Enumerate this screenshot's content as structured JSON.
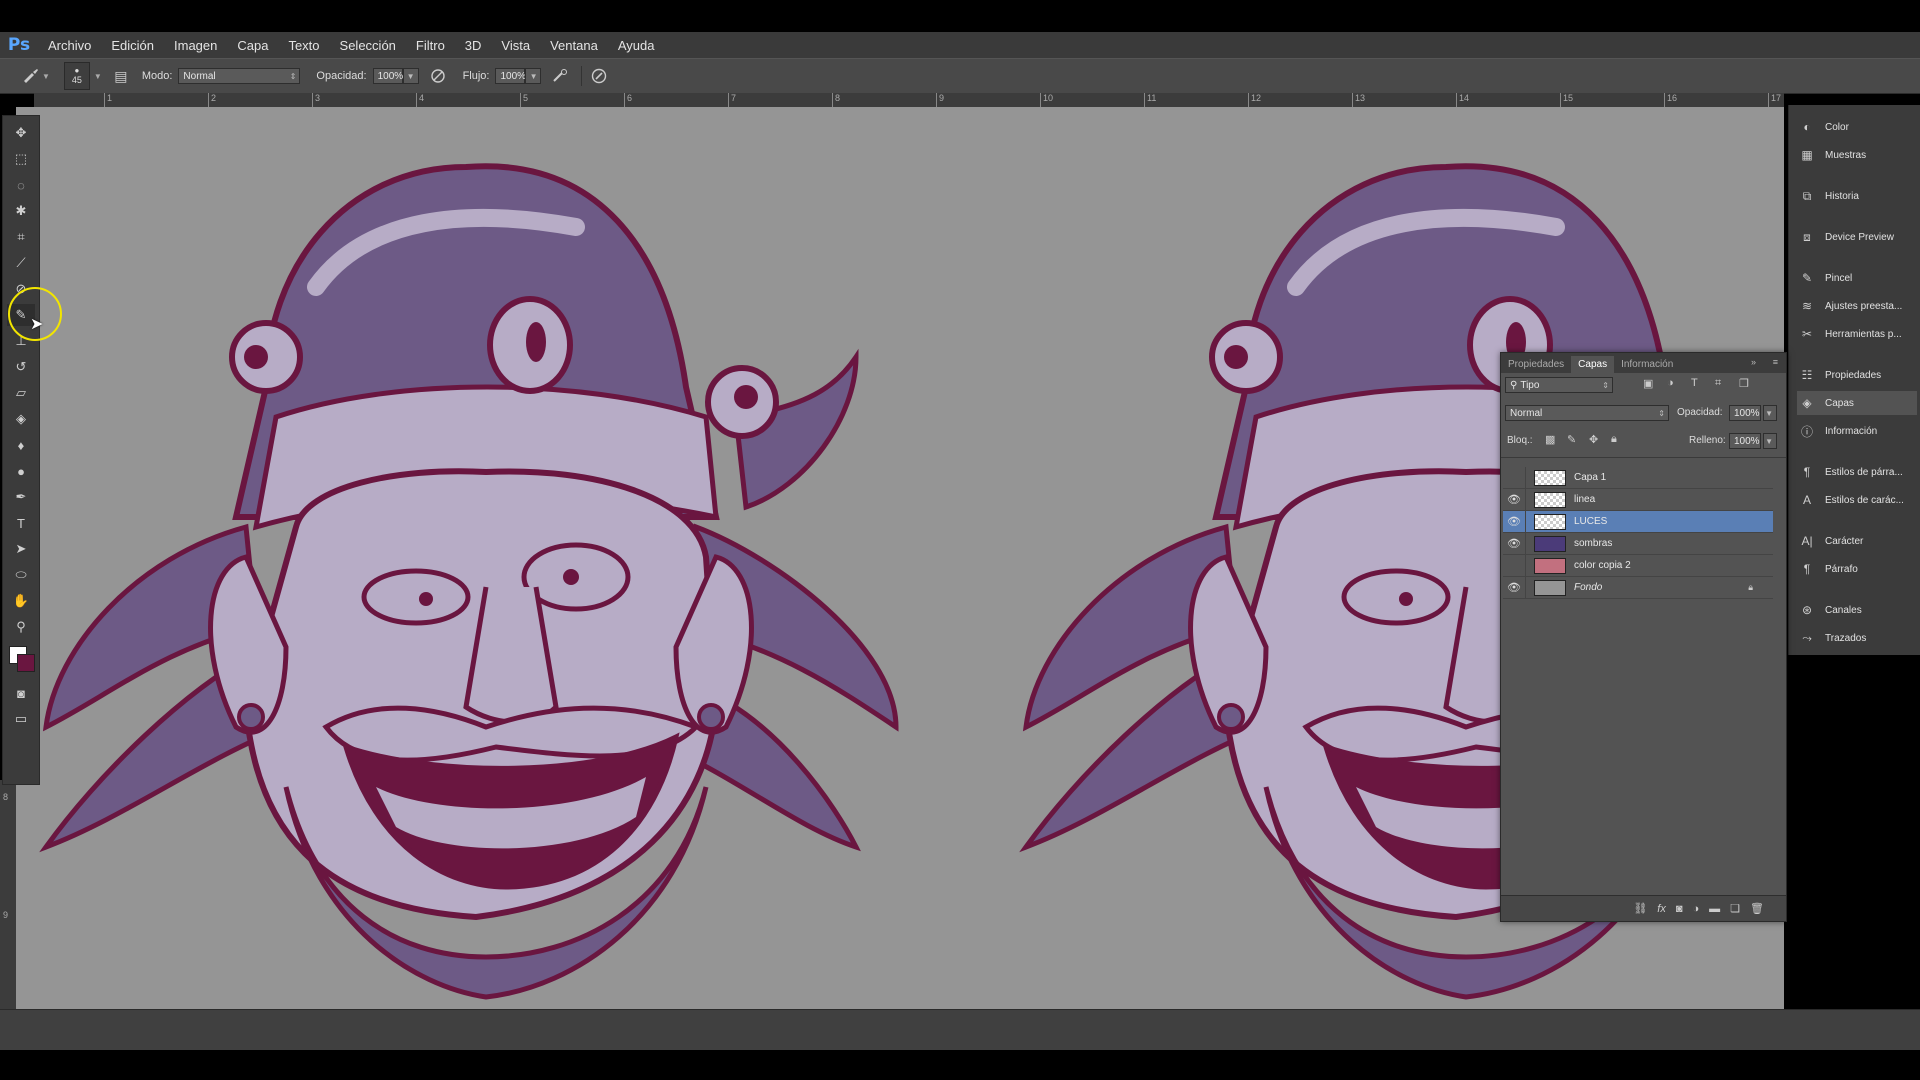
{
  "app": {
    "logo": "Ps"
  },
  "menu": [
    "Archivo",
    "Edición",
    "Imagen",
    "Capa",
    "Texto",
    "Selección",
    "Filtro",
    "3D",
    "Vista",
    "Ventana",
    "Ayuda"
  ],
  "options": {
    "brush_size": "45",
    "mode_label": "Modo:",
    "mode_value": "Normal",
    "opacity_label": "Opacidad:",
    "opacity_value": "100%",
    "flow_label": "Flujo:",
    "flow_value": "100%"
  },
  "ruler": [
    "1",
    "2",
    "3",
    "4",
    "5",
    "6",
    "7",
    "8",
    "9",
    "10",
    "11",
    "12",
    "13",
    "14",
    "15",
    "16",
    "17"
  ],
  "vruler": [
    "8",
    "9",
    "1",
    "0"
  ],
  "dock": [
    {
      "icon": "color-icon",
      "label": "Color"
    },
    {
      "icon": "swatches-icon",
      "label": "Muestras"
    },
    {
      "icon": "history-icon",
      "label": "Historia"
    },
    {
      "icon": "device-preview-icon",
      "label": "Device Preview"
    },
    {
      "icon": "brush-icon",
      "label": "Pincel"
    },
    {
      "icon": "brush-presets-icon",
      "label": "Ajustes preesta..."
    },
    {
      "icon": "tool-presets-icon",
      "label": "Herramientas p..."
    },
    {
      "icon": "properties-icon",
      "label": "Propiedades"
    },
    {
      "icon": "layers-icon",
      "label": "Capas"
    },
    {
      "icon": "info-icon",
      "label": "Información"
    },
    {
      "icon": "paragraph-styles-icon",
      "label": "Estilos de párra..."
    },
    {
      "icon": "character-styles-icon",
      "label": "Estilos de carác..."
    },
    {
      "icon": "character-icon",
      "label": "Carácter"
    },
    {
      "icon": "paragraph-icon",
      "label": "Párrafo"
    },
    {
      "icon": "channels-icon",
      "label": "Canales"
    },
    {
      "icon": "paths-icon",
      "label": "Trazados"
    }
  ],
  "layers_panel": {
    "tabs": [
      "Propiedades",
      "Capas",
      "Información"
    ],
    "filter": "Tipo",
    "blend": "Normal",
    "opacity_label": "Opacidad:",
    "opacity_value": "100%",
    "lock_label": "Bloq.:",
    "fill_label": "Relleno:",
    "fill_value": "100%",
    "layers": [
      {
        "name": "Capa 1",
        "visible": false,
        "selected": false
      },
      {
        "name": "linea",
        "visible": true,
        "selected": false
      },
      {
        "name": "LUCES",
        "visible": true,
        "selected": true
      },
      {
        "name": "sombras",
        "visible": true,
        "selected": false
      },
      {
        "name": "color copia 2",
        "visible": false,
        "selected": false
      },
      {
        "name": "Fondo",
        "visible": true,
        "selected": false,
        "locked": true
      }
    ]
  },
  "colors": {
    "canvas": "#959595",
    "line": "#6a1640",
    "fill": "#6d5a86",
    "light": "#b7acc6",
    "highlight": "#f2e500"
  }
}
